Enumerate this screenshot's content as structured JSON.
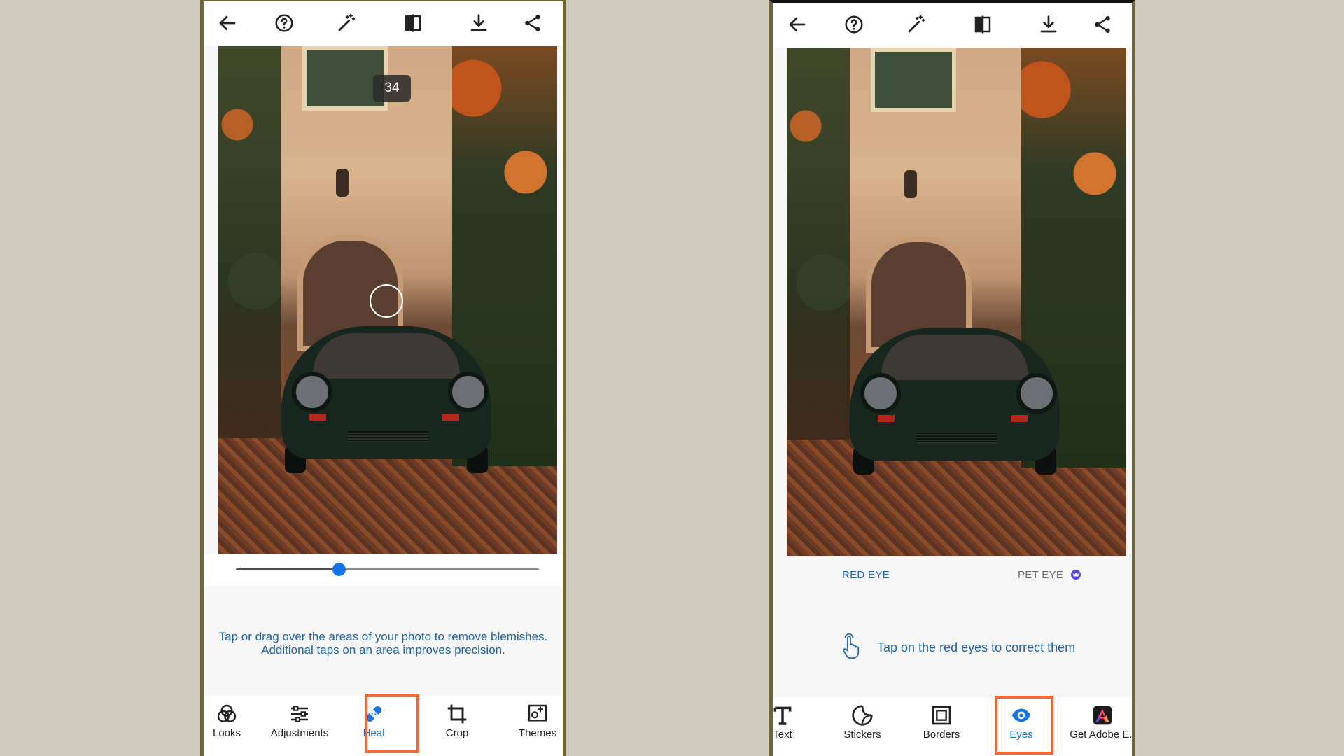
{
  "left": {
    "brush_size": "34",
    "slider_value": 0.34,
    "hint_line1": "Tap or drag over the areas of your photo to remove blemishes.",
    "hint_line2": "Additional taps on an area improves precision.",
    "nav": [
      {
        "label": "Looks",
        "icon": "looks-icon"
      },
      {
        "label": "Adjustments",
        "icon": "adjustments-icon"
      },
      {
        "label": "Heal",
        "icon": "heal-bandage-icon",
        "selected": true
      },
      {
        "label": "Crop",
        "icon": "crop-icon"
      },
      {
        "label": "Themes",
        "icon": "themes-icon"
      }
    ]
  },
  "right": {
    "tabs": [
      {
        "label": "RED EYE",
        "selected": true
      },
      {
        "label": "PET EYE",
        "premium_badge": true
      }
    ],
    "hint": "Tap on the red eyes to correct them",
    "nav": [
      {
        "label": "Text",
        "icon": "text-icon"
      },
      {
        "label": "Stickers",
        "icon": "stickers-icon"
      },
      {
        "label": "Borders",
        "icon": "borders-icon"
      },
      {
        "label": "Eyes",
        "icon": "eye-icon",
        "selected": true
      },
      {
        "label": "Get Adobe E..",
        "icon": "adobe-express-icon"
      }
    ]
  },
  "toolbar_icons": [
    "back-arrow-icon",
    "help-icon",
    "magic-wand-icon",
    "compare-icon",
    "download-icon",
    "share-icon"
  ],
  "colors": {
    "accent": "#1473e6",
    "highlight_border": "#f0693b",
    "hint_text": "#1f63a8",
    "frame": "#6e6636",
    "background": "#cfcbbd"
  }
}
